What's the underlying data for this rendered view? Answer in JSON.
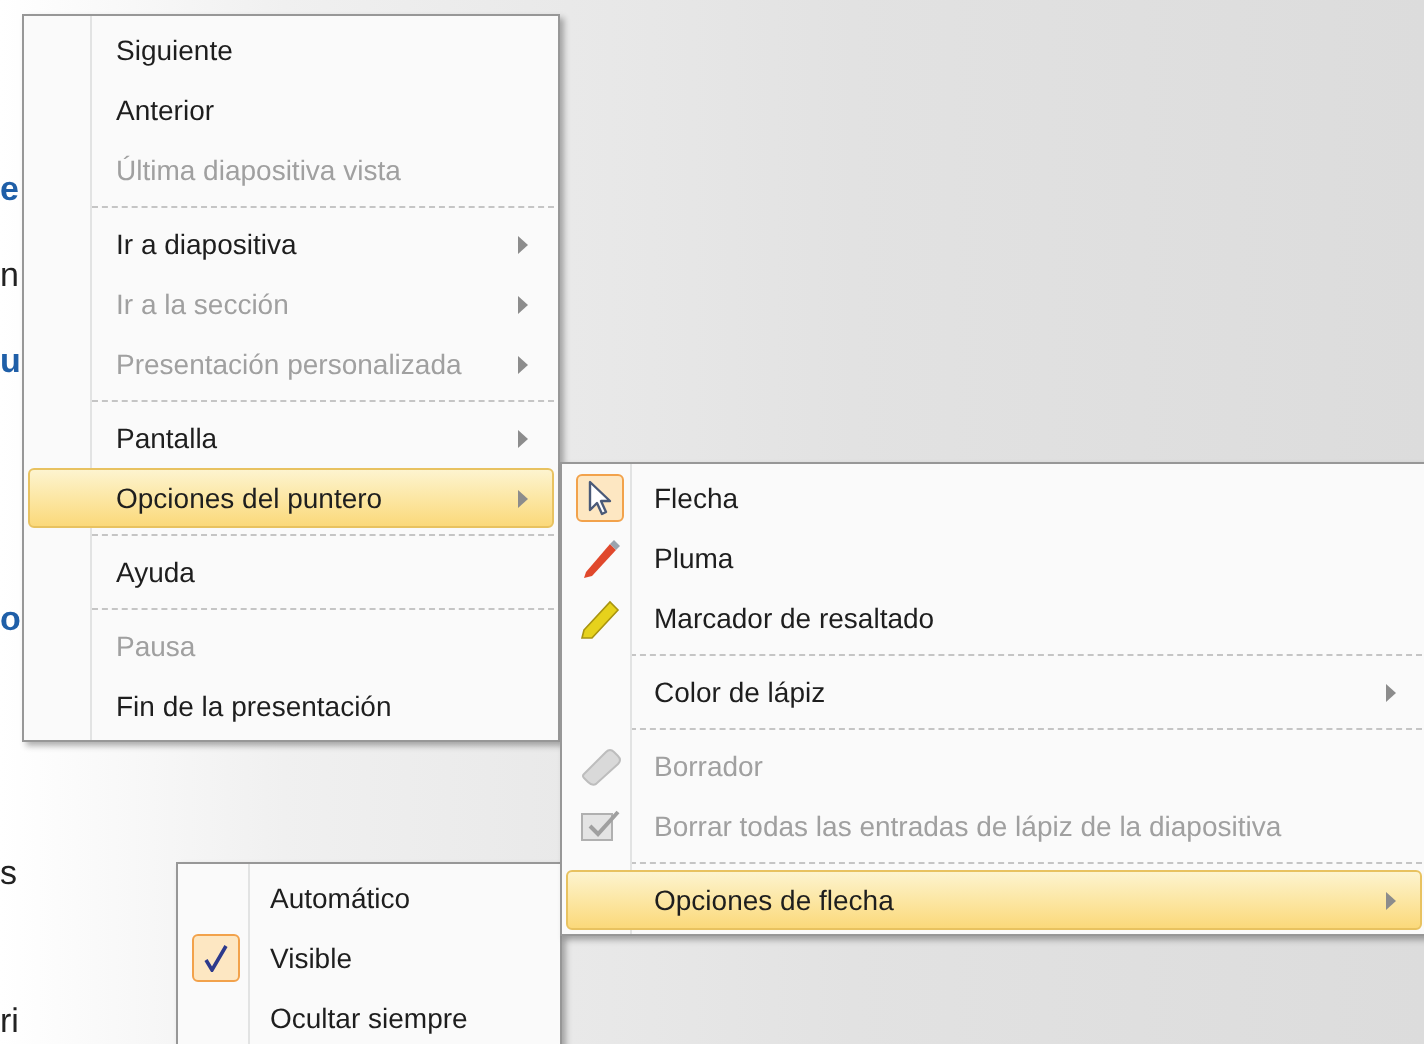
{
  "slide_fragments": [
    {
      "text": "e",
      "kind": "heading"
    },
    {
      "text": "n",
      "kind": "body"
    },
    {
      "text": "u",
      "kind": "heading"
    },
    {
      "text": "o",
      "kind": "heading"
    },
    {
      "text": "s",
      "kind": "body"
    },
    {
      "text": "ri",
      "kind": "body"
    }
  ],
  "context_menu": {
    "items": [
      {
        "kind": "item",
        "label": "Siguiente",
        "disabled": false,
        "submenu": false,
        "selected": false
      },
      {
        "kind": "item",
        "label": "Anterior",
        "disabled": false,
        "submenu": false,
        "selected": false
      },
      {
        "kind": "item",
        "label": "Última diapositiva vista",
        "disabled": true,
        "submenu": false,
        "selected": false
      },
      {
        "kind": "separator"
      },
      {
        "kind": "item",
        "label": "Ir a diapositiva",
        "disabled": false,
        "submenu": true,
        "selected": false
      },
      {
        "kind": "item",
        "label": "Ir a la sección",
        "disabled": true,
        "submenu": true,
        "selected": false
      },
      {
        "kind": "item",
        "label": "Presentación personalizada",
        "disabled": true,
        "submenu": true,
        "selected": false
      },
      {
        "kind": "separator"
      },
      {
        "kind": "item",
        "label": "Pantalla",
        "disabled": false,
        "submenu": true,
        "selected": false
      },
      {
        "kind": "item",
        "label": "Opciones del puntero",
        "disabled": false,
        "submenu": true,
        "selected": true
      },
      {
        "kind": "separator"
      },
      {
        "kind": "item",
        "label": "Ayuda",
        "disabled": false,
        "submenu": false,
        "selected": false
      },
      {
        "kind": "separator"
      },
      {
        "kind": "item",
        "label": "Pausa",
        "disabled": true,
        "submenu": false,
        "selected": false
      },
      {
        "kind": "item",
        "label": "Fin de la presentación",
        "disabled": false,
        "submenu": false,
        "selected": false
      }
    ]
  },
  "pointer_submenu": {
    "items": [
      {
        "kind": "item",
        "label": "Flecha",
        "disabled": false,
        "submenu": false,
        "selected": false,
        "checked": true
      },
      {
        "kind": "item",
        "label": "Pluma",
        "disabled": false,
        "submenu": false,
        "selected": false,
        "checked": false
      },
      {
        "kind": "item",
        "label": "Marcador de resaltado",
        "disabled": false,
        "submenu": false,
        "selected": false,
        "checked": false
      },
      {
        "kind": "separator"
      },
      {
        "kind": "item",
        "label": "Color de lápiz",
        "disabled": false,
        "submenu": true,
        "selected": false,
        "checked": false
      },
      {
        "kind": "separator"
      },
      {
        "kind": "item",
        "label": "Borrador",
        "disabled": true,
        "submenu": false,
        "selected": false,
        "checked": false
      },
      {
        "kind": "item",
        "label": "Borrar todas las entradas de lápiz de la diapositiva",
        "disabled": true,
        "submenu": false,
        "selected": false,
        "checked": false
      },
      {
        "kind": "separator"
      },
      {
        "kind": "item",
        "label": "Opciones de flecha",
        "disabled": false,
        "submenu": true,
        "selected": true,
        "checked": false
      }
    ]
  },
  "arrow_submenu": {
    "items": [
      {
        "kind": "item",
        "label": "Automático",
        "disabled": false,
        "submenu": false,
        "selected": false,
        "checked": false
      },
      {
        "kind": "item",
        "label": "Visible",
        "disabled": false,
        "submenu": false,
        "selected": false,
        "checked": true
      },
      {
        "kind": "item",
        "label": "Ocultar siempre",
        "disabled": false,
        "submenu": false,
        "selected": false,
        "checked": false
      }
    ]
  }
}
